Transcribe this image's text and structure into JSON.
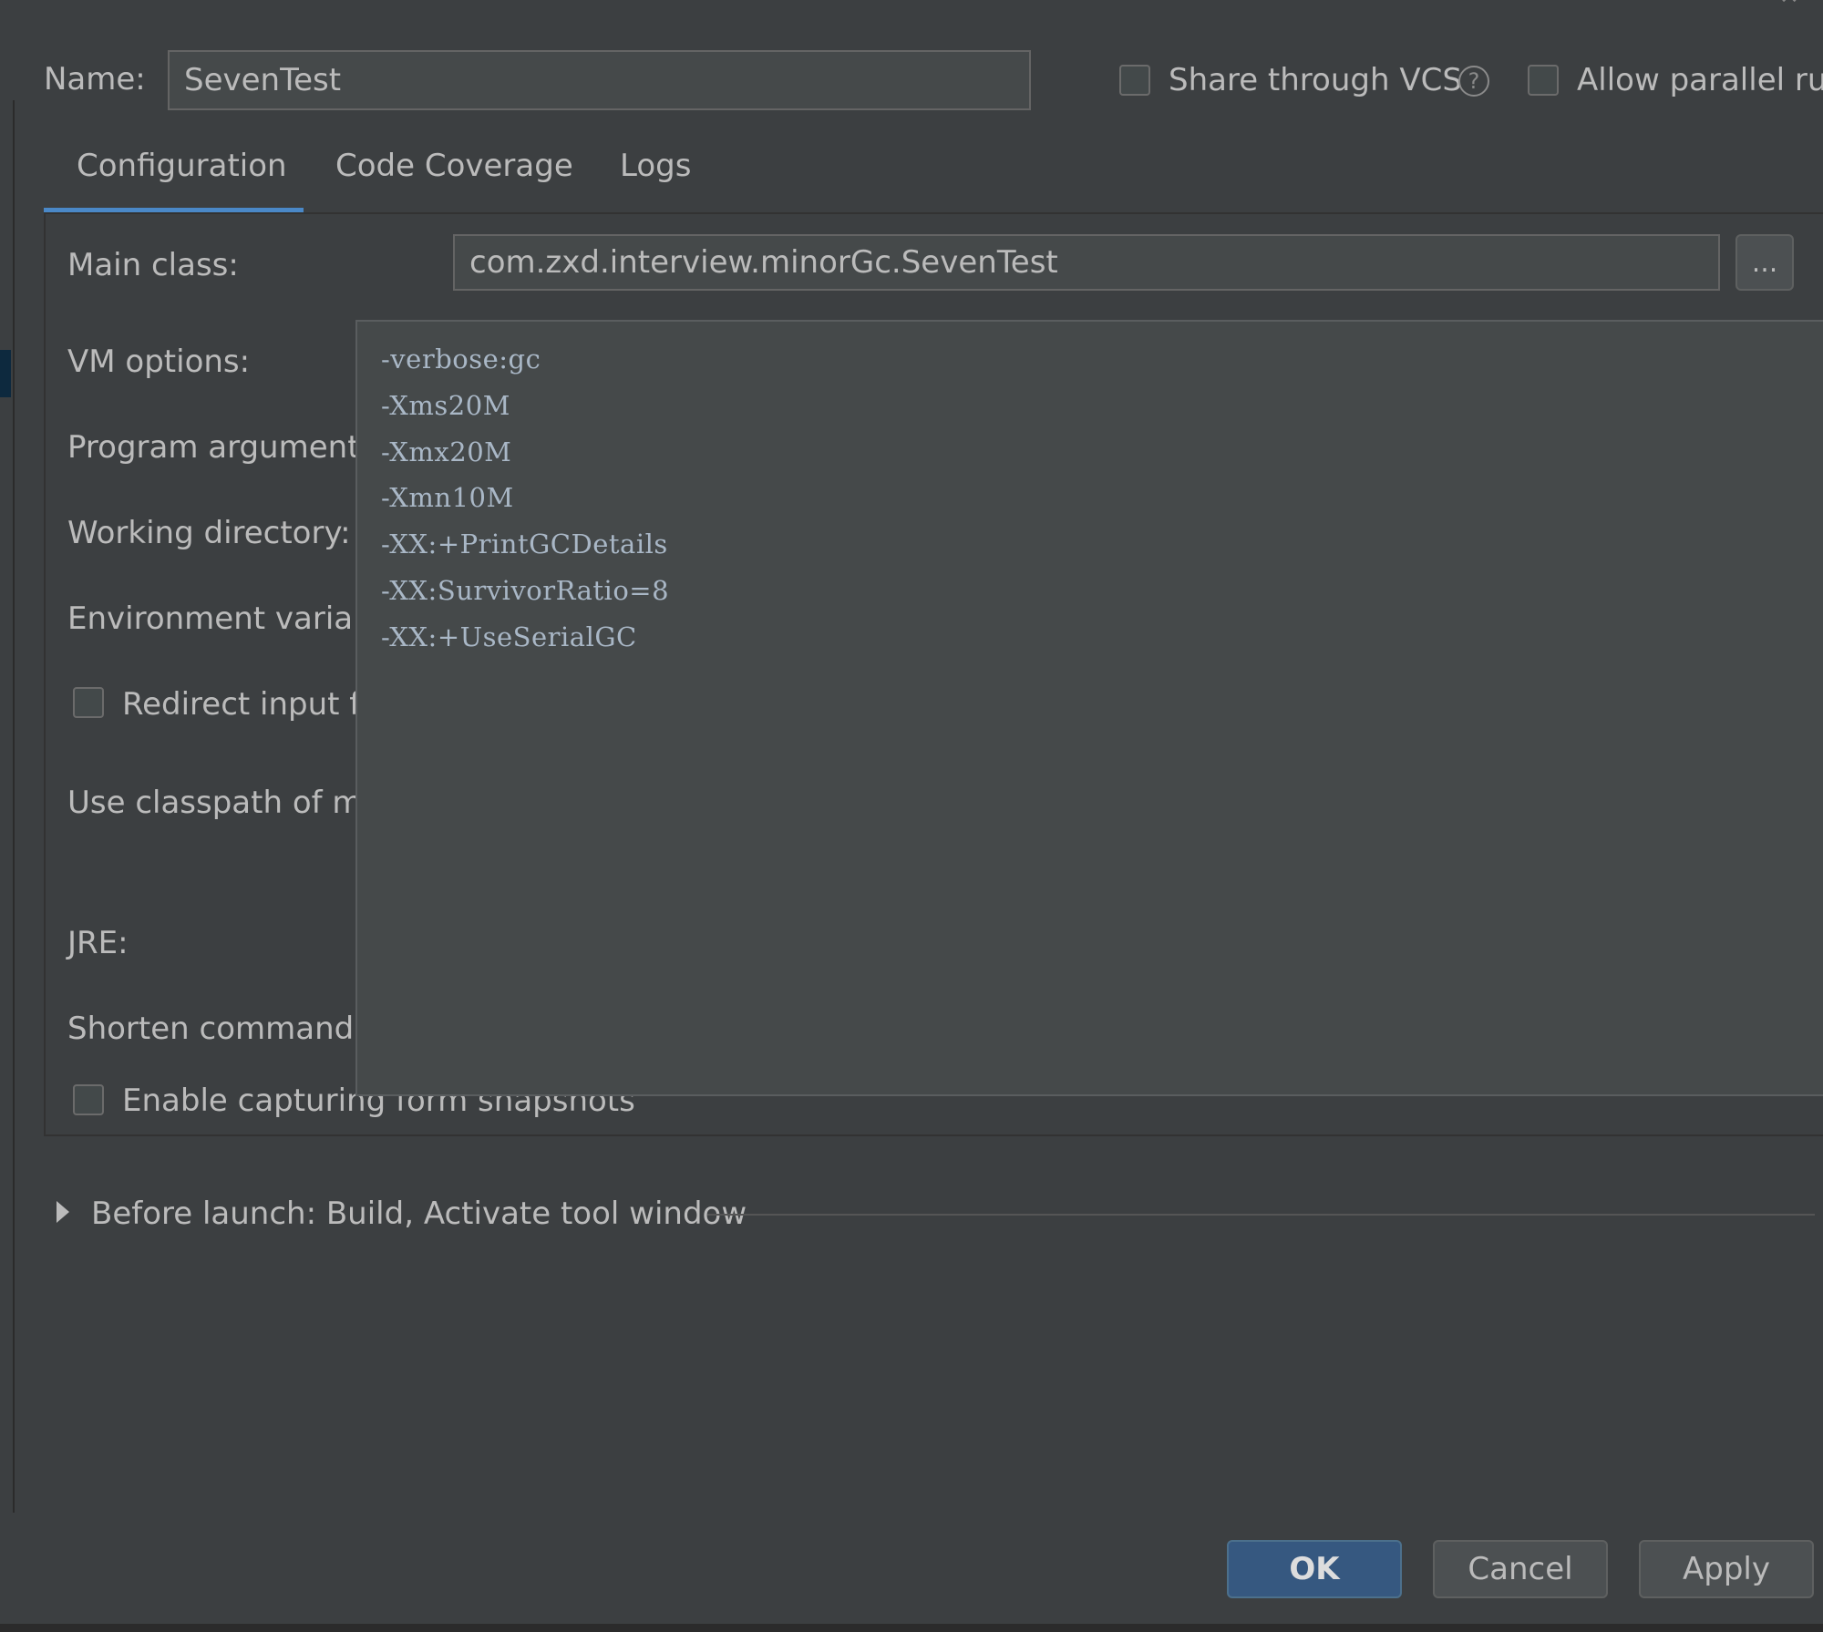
{
  "header": {
    "name_label": "Name:",
    "name_value": "SevenTest",
    "share_vcs_label": "Share through VCS",
    "help_glyph": "?",
    "allow_parallel_label": "Allow parallel run"
  },
  "tabs": [
    {
      "label": "Configuration",
      "selected": true
    },
    {
      "label": "Code Coverage",
      "selected": false
    },
    {
      "label": "Logs",
      "selected": false
    }
  ],
  "form": {
    "main_class_label": "Main class:",
    "main_class_value": "com.zxd.interview.minorGc.SevenTest",
    "browse_label": "...",
    "vm_options_label": "VM options:",
    "program_arguments_label": "Program arguments:",
    "working_directory_label": "Working directory:",
    "environment_variables_label": "Environment variables:",
    "redirect_input_label": "Redirect input from:",
    "use_classpath_label": "Use classpath of module:",
    "jre_label": "JRE:",
    "shorten_command_label": "Shorten command line:",
    "enable_capturing_label": "Enable capturing form snapshots"
  },
  "vm_options_lines": [
    "-verbose:gc",
    "-Xms20M",
    "-Xmx20M",
    "-Xmn10M",
    "-XX:+PrintGCDetails",
    "-XX:SurvivorRatio=8",
    "-XX:+UseSerialGC"
  ],
  "before_launch": {
    "label": "Before launch: Build, Activate tool window"
  },
  "footer": {
    "ok_label": "OK",
    "cancel_label": "Cancel",
    "apply_label": "Apply"
  },
  "colors": {
    "background": "#3c3f41",
    "field": "#45494a",
    "accent": "#4a88c7",
    "primary_button": "#365880"
  },
  "icons": {
    "help": "question-circle-icon",
    "expand": "triangle-right-icon",
    "close": "close-icon"
  }
}
